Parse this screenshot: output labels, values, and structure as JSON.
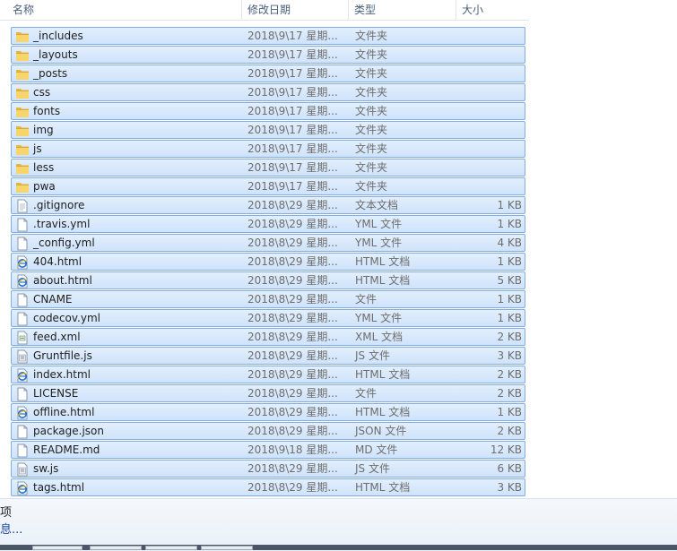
{
  "columns": {
    "name": "名称",
    "date": "修改日期",
    "type": "类型",
    "size": "大小"
  },
  "files": [
    {
      "name": "_includes",
      "date": "2018\\9\\17 星期...",
      "type": "文件夹",
      "size": "",
      "icon": "folder-icon"
    },
    {
      "name": "_layouts",
      "date": "2018\\9\\17 星期...",
      "type": "文件夹",
      "size": "",
      "icon": "folder-icon"
    },
    {
      "name": "_posts",
      "date": "2018\\9\\17 星期...",
      "type": "文件夹",
      "size": "",
      "icon": "folder-icon"
    },
    {
      "name": "css",
      "date": "2018\\9\\17 星期...",
      "type": "文件夹",
      "size": "",
      "icon": "folder-icon"
    },
    {
      "name": "fonts",
      "date": "2018\\9\\17 星期...",
      "type": "文件夹",
      "size": "",
      "icon": "folder-icon"
    },
    {
      "name": "img",
      "date": "2018\\9\\17 星期...",
      "type": "文件夹",
      "size": "",
      "icon": "folder-icon"
    },
    {
      "name": "js",
      "date": "2018\\9\\17 星期...",
      "type": "文件夹",
      "size": "",
      "icon": "folder-icon"
    },
    {
      "name": "less",
      "date": "2018\\9\\17 星期...",
      "type": "文件夹",
      "size": "",
      "icon": "folder-icon"
    },
    {
      "name": "pwa",
      "date": "2018\\9\\17 星期...",
      "type": "文件夹",
      "size": "",
      "icon": "folder-icon"
    },
    {
      "name": ".gitignore",
      "date": "2018\\8\\29 星期...",
      "type": "文本文档",
      "size": "1 KB",
      "icon": "text-file-icon"
    },
    {
      "name": ".travis.yml",
      "date": "2018\\8\\29 星期...",
      "type": "YML 文件",
      "size": "1 KB",
      "icon": "blank-file-icon"
    },
    {
      "name": "_config.yml",
      "date": "2018\\8\\29 星期...",
      "type": "YML 文件",
      "size": "4 KB",
      "icon": "blank-file-icon"
    },
    {
      "name": "404.html",
      "date": "2018\\8\\29 星期...",
      "type": "HTML 文档",
      "size": "1 KB",
      "icon": "html-file-icon"
    },
    {
      "name": "about.html",
      "date": "2018\\8\\29 星期...",
      "type": "HTML 文档",
      "size": "5 KB",
      "icon": "html-file-icon"
    },
    {
      "name": "CNAME",
      "date": "2018\\8\\29 星期...",
      "type": "文件",
      "size": "1 KB",
      "icon": "blank-file-icon"
    },
    {
      "name": "codecov.yml",
      "date": "2018\\8\\29 星期...",
      "type": "YML 文件",
      "size": "1 KB",
      "icon": "blank-file-icon"
    },
    {
      "name": "feed.xml",
      "date": "2018\\8\\29 星期...",
      "type": "XML 文档",
      "size": "2 KB",
      "icon": "xml-file-icon"
    },
    {
      "name": "Gruntfile.js",
      "date": "2018\\8\\29 星期...",
      "type": "JS 文件",
      "size": "3 KB",
      "icon": "script-file-icon"
    },
    {
      "name": "index.html",
      "date": "2018\\8\\29 星期...",
      "type": "HTML 文档",
      "size": "2 KB",
      "icon": "html-file-icon"
    },
    {
      "name": "LICENSE",
      "date": "2018\\8\\29 星期...",
      "type": "文件",
      "size": "2 KB",
      "icon": "blank-file-icon"
    },
    {
      "name": "offline.html",
      "date": "2018\\8\\29 星期...",
      "type": "HTML 文档",
      "size": "1 KB",
      "icon": "html-file-icon"
    },
    {
      "name": "package.json",
      "date": "2018\\8\\29 星期...",
      "type": "JSON 文件",
      "size": "2 KB",
      "icon": "blank-file-icon"
    },
    {
      "name": "README.md",
      "date": "2018\\9\\18 星期...",
      "type": "MD 文件",
      "size": "12 KB",
      "icon": "blank-file-icon"
    },
    {
      "name": "sw.js",
      "date": "2018\\8\\29 星期...",
      "type": "JS 文件",
      "size": "6 KB",
      "icon": "script-file-icon"
    },
    {
      "name": "tags.html",
      "date": "2018\\8\\29 星期...",
      "type": "HTML 文档",
      "size": "3 KB",
      "icon": "html-file-icon"
    }
  ],
  "details": {
    "line1": "项",
    "line2": "息..."
  },
  "colors": {
    "selection_bg": "#cfe3fb",
    "selection_border": "#84acdd",
    "header_text": "#4c607a",
    "link_text": "#1e4c9a"
  }
}
